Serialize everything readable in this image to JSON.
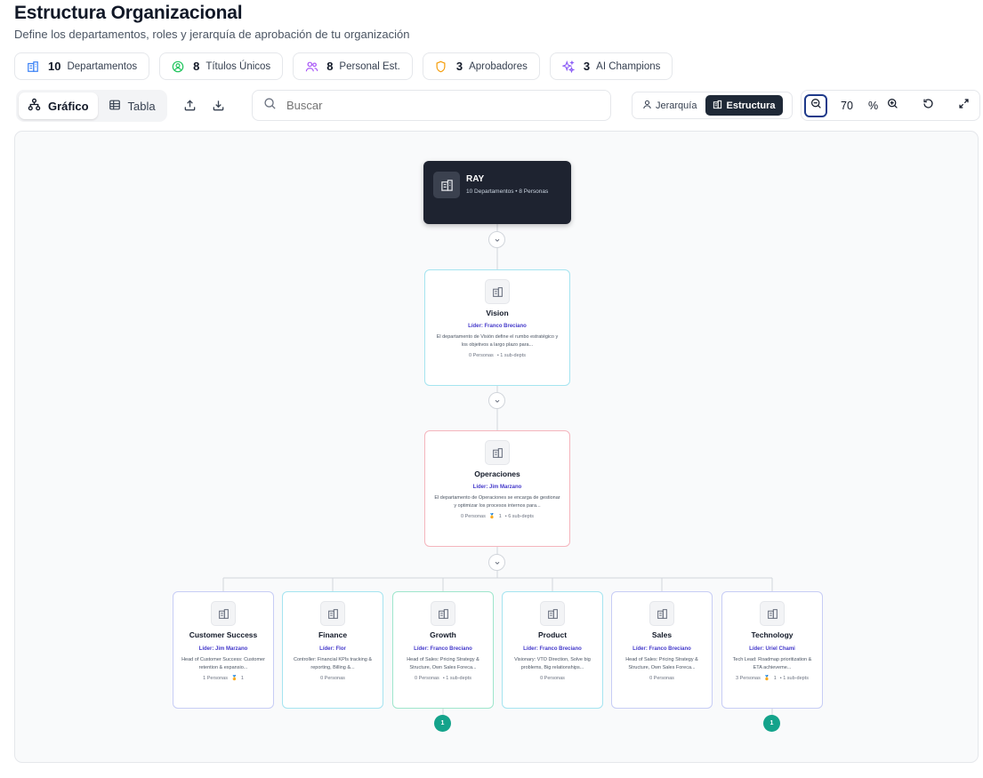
{
  "header": {
    "title": "Estructura Organizacional",
    "subtitle": "Define los departamentos, roles y jerarquía de aprobación de tu organización"
  },
  "stats": [
    {
      "value": "10",
      "label": "Departamentos",
      "icon": "building-icon",
      "color": "#3b82f6"
    },
    {
      "value": "8",
      "label": "Títulos Únicos",
      "icon": "user-circle-icon",
      "color": "#22c55e"
    },
    {
      "value": "8",
      "label": "Personal Est.",
      "icon": "users-icon",
      "color": "#a855f7"
    },
    {
      "value": "3",
      "label": "Aprobadores",
      "icon": "shield-icon",
      "color": "#f59e0b"
    },
    {
      "value": "3",
      "label": "AI Champions",
      "icon": "sparkles-icon",
      "color": "#8b5cf6"
    }
  ],
  "toolbar": {
    "view_graph": "Gráfico",
    "view_table": "Tabla",
    "search_placeholder": "Buscar",
    "mode_hierarchy": "Jerarquía",
    "mode_structure": "Estructura",
    "zoom_value": "70",
    "zoom_unit": "%"
  },
  "org": {
    "root": {
      "name": "RAY",
      "meta": "10 Departamentos • 8 Personas"
    },
    "vision": {
      "name": "Vision",
      "leader": "Líder: Franco Breciano",
      "desc": "El departamento de Visión define el rumbo estratégico y los objetivos a largo plazo para...",
      "people": "0 Personas",
      "subdepts": "• 1 sub-depts",
      "border": "#a5e4f0"
    },
    "operaciones": {
      "name": "Operaciones",
      "leader": "Líder: Jim Marzano",
      "desc": "El departamento de Operaciones se encarga de gestionar y optimizar los procesos internos para...",
      "people": "0 Personas",
      "champions": "1",
      "subdepts": "• 6 sub-depts",
      "border": "#f5b5bd"
    },
    "children": [
      {
        "name": "Customer Success",
        "leader": "Líder: Jim Marzano",
        "desc": "Head of Customer Success: Customer retention & expansio...",
        "people": "1 Personas",
        "champions": "1",
        "subdepts": "",
        "border": "#c7cdf5"
      },
      {
        "name": "Finance",
        "leader": "Líder: Flor",
        "desc": "Controller: Financial KPIs tracking & reporting, Billing &...",
        "people": "0 Personas",
        "champions": "",
        "subdepts": "",
        "border": "#a5e4f0"
      },
      {
        "name": "Growth",
        "leader": "Líder: Franco Breciano",
        "desc": "Head of Sales: Pricing Strategy & Structure, Own Sales Foreca...",
        "people": "0 Personas",
        "champions": "",
        "subdepts": "• 1 sub-depts",
        "border": "#9ee6cc",
        "badge": "1"
      },
      {
        "name": "Product",
        "leader": "Líder: Franco Breciano",
        "desc": "Visionary: VTO Direction, Solve big problems, Big relationships...",
        "people": "0 Personas",
        "champions": "",
        "subdepts": "",
        "border": "#a5e4f0"
      },
      {
        "name": "Sales",
        "leader": "Líder: Franco Breciano",
        "desc": "Head of Sales: Pricing Strategy & Structure, Own Sales Foreca...",
        "people": "0 Personas",
        "champions": "",
        "subdepts": "",
        "border": "#c7cdf5"
      },
      {
        "name": "Technology",
        "leader": "Líder: Uriel Chami",
        "desc": "Tech Lead: Roadmap prioritization & ETA achieveme...",
        "people": "3 Personas",
        "champions": "1",
        "subdepts": "• 1 sub-depts",
        "border": "#c7cdf5",
        "badge": "1"
      }
    ]
  }
}
